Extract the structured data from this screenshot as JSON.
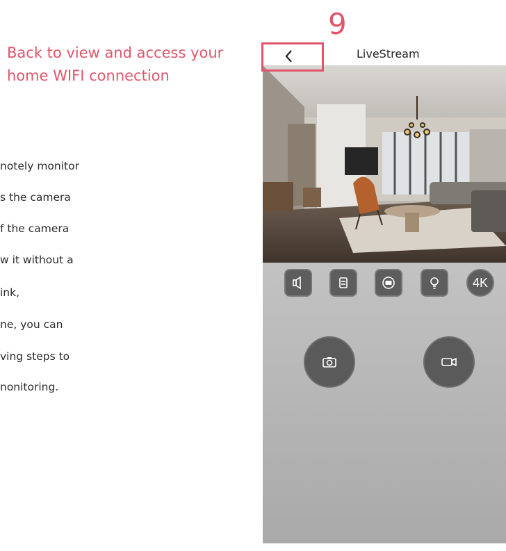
{
  "annotation": {
    "line1": "Back to view and access your",
    "line2": "home WIFI connection",
    "step_number": "9"
  },
  "body_lines": [
    "notely monitor",
    "s the camera",
    "f the camera",
    "w it without a",
    "ink,",
    "ne, you can",
    "ving steps to",
    "nonitoring."
  ],
  "app": {
    "title": "LiveStream",
    "controls": {
      "c1_icon": "speaker-icon",
      "c2_icon": "hourglass-icon",
      "c3_icon": "sd-card-icon",
      "c4_icon": "bulb-icon",
      "hd_label": "4K"
    },
    "snapshot_icon": "camera-icon",
    "record_icon": "video-icon"
  },
  "colors": {
    "annotation": "#e0556a",
    "control_bg": "#5d5d5d",
    "panel_top": "#e2e2e2",
    "panel_bottom": "#a9a9a9"
  }
}
